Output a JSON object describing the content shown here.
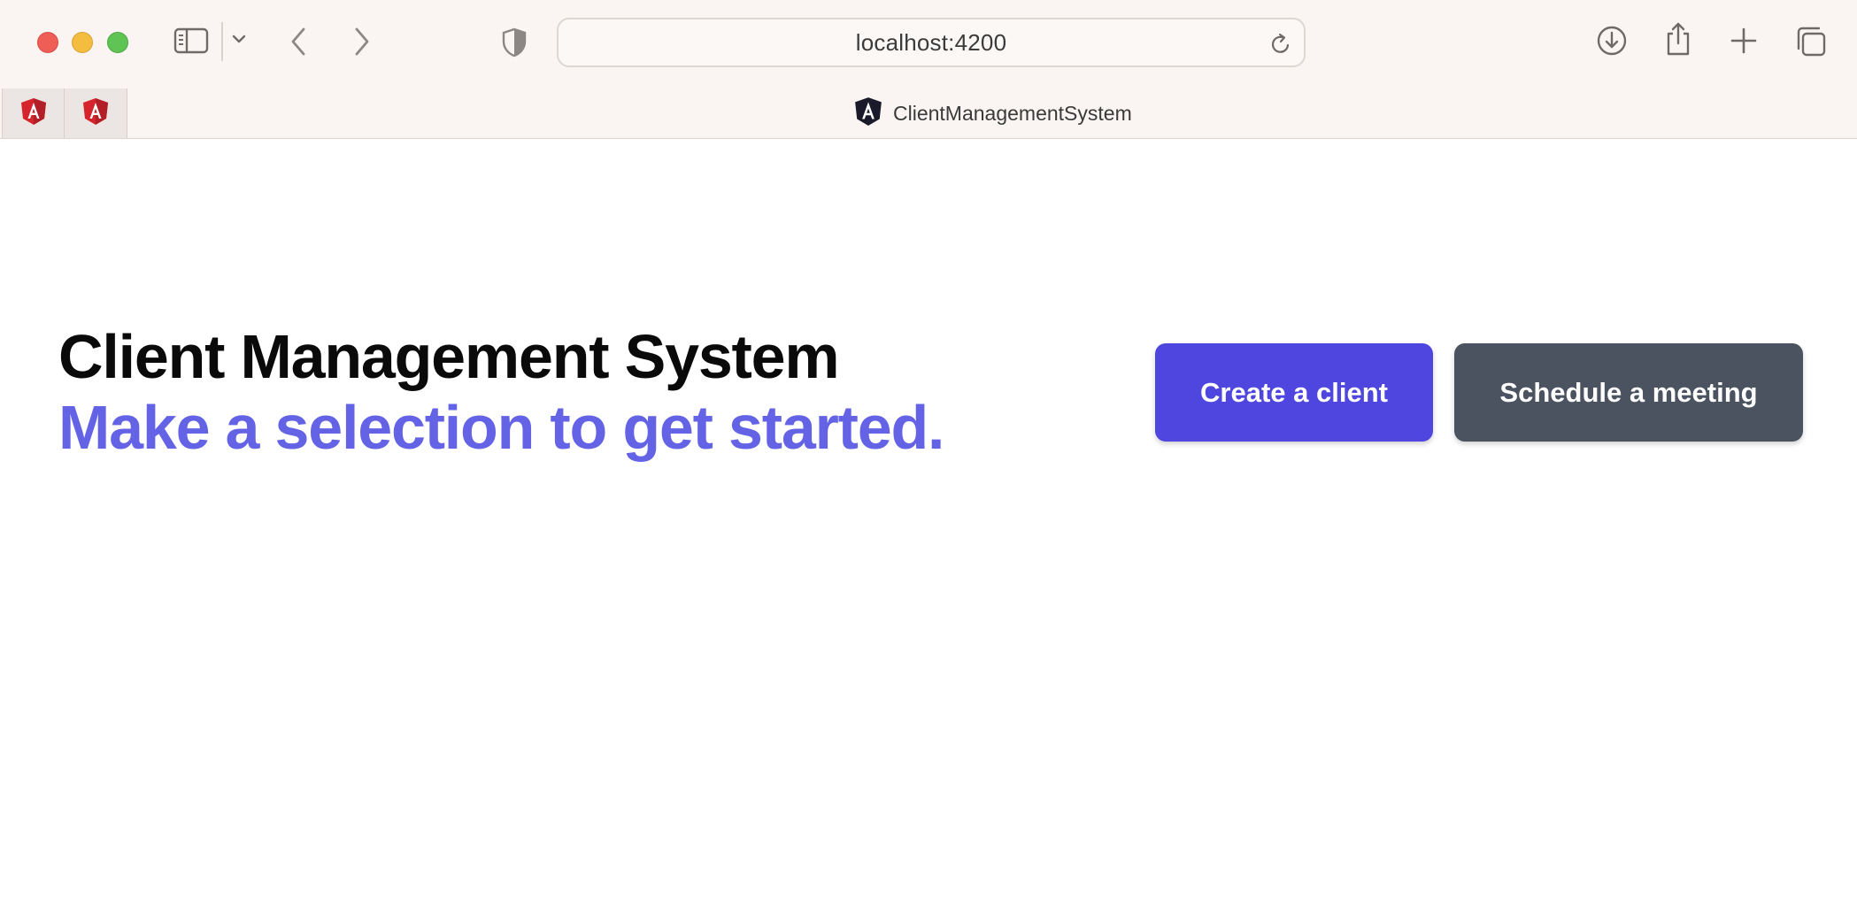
{
  "browser": {
    "address": "localhost:4200",
    "active_tab_title": "ClientManagementSystem",
    "pinned_tabs": [
      "angular-icon",
      "angular-icon"
    ]
  },
  "page": {
    "title": "Client Management System",
    "subtitle": "Make a selection to get started.",
    "create_button": "Create a client",
    "schedule_button": "Schedule a meeting"
  },
  "colors": {
    "title": "#0a0a0a",
    "subtitle": "#6463e6",
    "create_button_bg": "#4f46e0",
    "schedule_button_bg": "#4b5260",
    "angular_red": "#d6242c",
    "chrome_bg": "#faf5f2"
  }
}
